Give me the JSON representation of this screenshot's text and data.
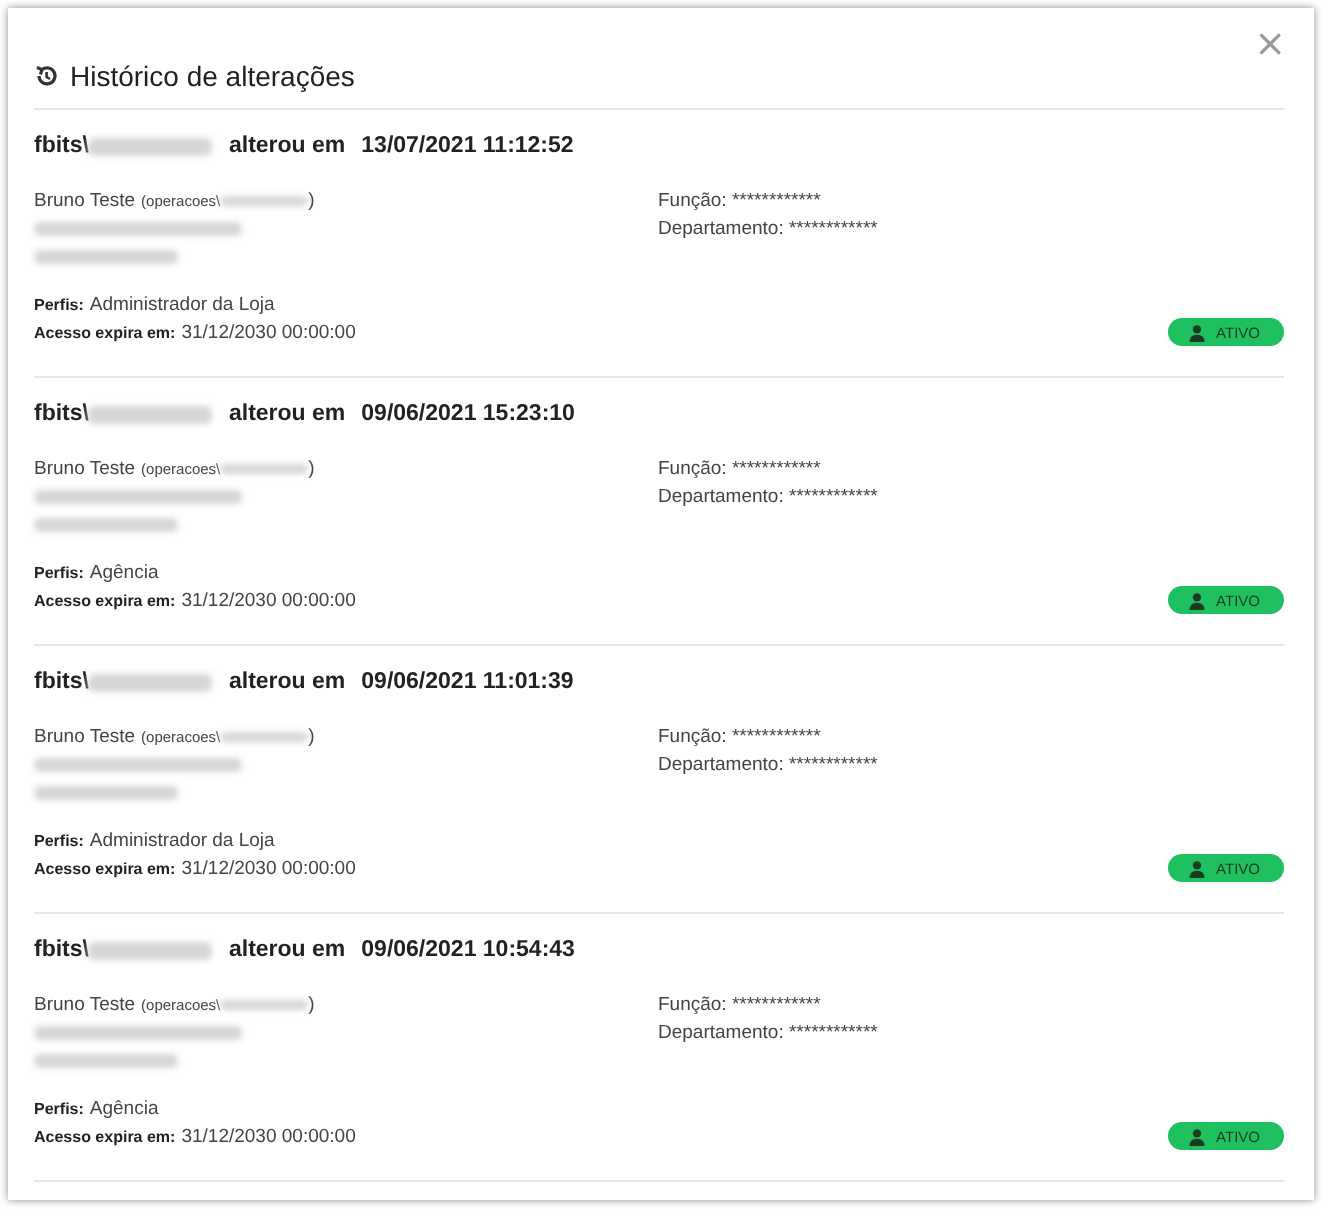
{
  "dialog": {
    "close": "×",
    "title": "Histórico de alterações"
  },
  "entries": [
    {
      "user_prefix": "fbits\\",
      "action": "alterou em",
      "when": "13/07/2021 11:12:52",
      "name": "Bruno Teste",
      "login_prefix": "(operacoes\\",
      "login_suffix": ")",
      "role_label": "Função:",
      "role": "************",
      "dept_label": "Departamento:",
      "dept": "************",
      "profiles_label": "Perfis:",
      "profiles": "Administrador da Loja",
      "expires_label": "Acesso expira em:",
      "expires": "31/12/2030 00:00:00",
      "status": "ATIVO"
    },
    {
      "user_prefix": "fbits\\",
      "action": "alterou em",
      "when": "09/06/2021 15:23:10",
      "name": "Bruno Teste",
      "login_prefix": "(operacoes\\",
      "login_suffix": ")",
      "role_label": "Função:",
      "role": "************",
      "dept_label": "Departamento:",
      "dept": "************",
      "profiles_label": "Perfis:",
      "profiles": "Agência",
      "expires_label": "Acesso expira em:",
      "expires": "31/12/2030 00:00:00",
      "status": "ATIVO"
    },
    {
      "user_prefix": "fbits\\",
      "action": "alterou em",
      "when": "09/06/2021 11:01:39",
      "name": "Bruno Teste",
      "login_prefix": "(operacoes\\",
      "login_suffix": ")",
      "role_label": "Função:",
      "role": "************",
      "dept_label": "Departamento:",
      "dept": "************",
      "profiles_label": "Perfis:",
      "profiles": "Administrador da Loja",
      "expires_label": "Acesso expira em:",
      "expires": "31/12/2030 00:00:00",
      "status": "ATIVO"
    },
    {
      "user_prefix": "fbits\\",
      "action": "alterou em",
      "when": "09/06/2021 10:54:43",
      "name": "Bruno Teste",
      "login_prefix": "(operacoes\\",
      "login_suffix": ")",
      "role_label": "Função:",
      "role": "************",
      "dept_label": "Departamento:",
      "dept": "************",
      "profiles_label": "Perfis:",
      "profiles": "Agência",
      "expires_label": "Acesso expira em:",
      "expires": "31/12/2030 00:00:00",
      "status": "ATIVO"
    }
  ]
}
